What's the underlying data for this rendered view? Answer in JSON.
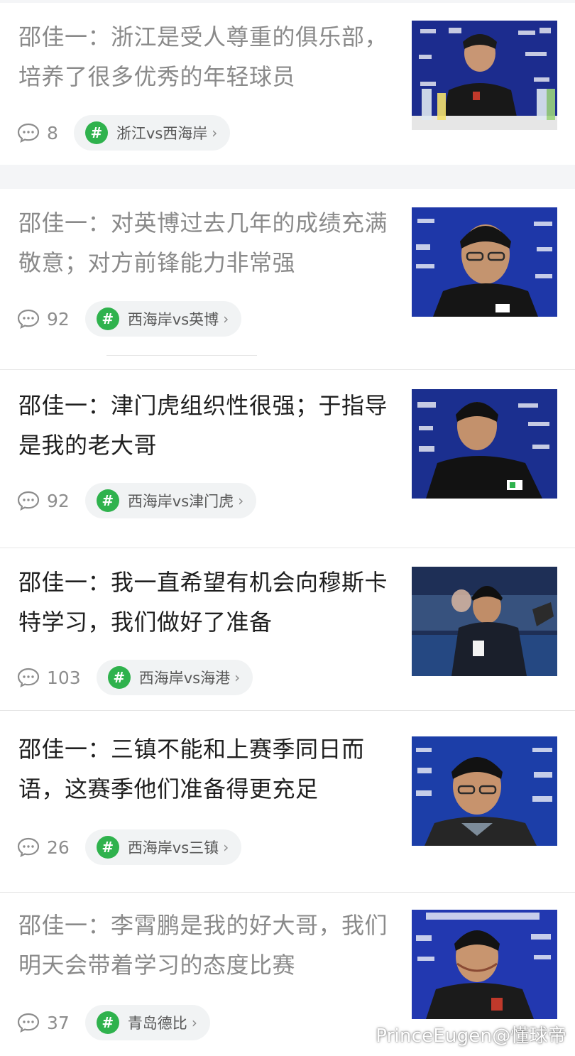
{
  "feed": {
    "items": [
      {
        "title": "邵佳一：浙江是受人尊重的俱乐部，培养了很多优秀的年轻球员",
        "comments": "8",
        "topic": "浙江vs西海岸",
        "read": true,
        "thumb_scene": "press-conference-blue-backdrop"
      },
      {
        "title": "邵佳一：对英博过去几年的成绩充满敬意；对方前锋能力非常强",
        "comments": "92",
        "topic": "西海岸vs英博",
        "read": true,
        "thumb_scene": "interview-closeup-glasses"
      },
      {
        "title": "邵佳一：津门虎组织性很强；于指导是我的老大哥",
        "comments": "92",
        "topic": "西海岸vs津门虎",
        "read": false,
        "thumb_scene": "interview-closeup"
      },
      {
        "title": "邵佳一：我一直希望有机会向穆斯卡特学习，我们做好了准备",
        "comments": "103",
        "topic": "西海岸vs海港",
        "read": false,
        "thumb_scene": "sideline-winter-coat"
      },
      {
        "title": "邵佳一：三镇不能和上赛季同日而语，这赛季他们准备得更充足",
        "comments": "26",
        "topic": "西海岸vs三镇",
        "read": false,
        "thumb_scene": "interview-closeup-glasses"
      },
      {
        "title": "邵佳一：李霄鹏是我的好大哥，我们明天会带着学习的态度比赛",
        "comments": "37",
        "topic": "青岛德比",
        "read": true,
        "thumb_scene": "press-conference-smile"
      }
    ]
  },
  "icons": {
    "comment": "comment-bubble-icon",
    "topic": "hashtag-icon",
    "chevron": "chevron-right-icon"
  },
  "colors": {
    "topic_icon_bg": "#2fb24d",
    "pill_bg": "#f1f3f4",
    "read_title": "#8a8a8a",
    "unread_title": "#1f1f1f",
    "meta_text": "#8d8d8d"
  },
  "watermark": "PrinceEugen@懂球帝"
}
